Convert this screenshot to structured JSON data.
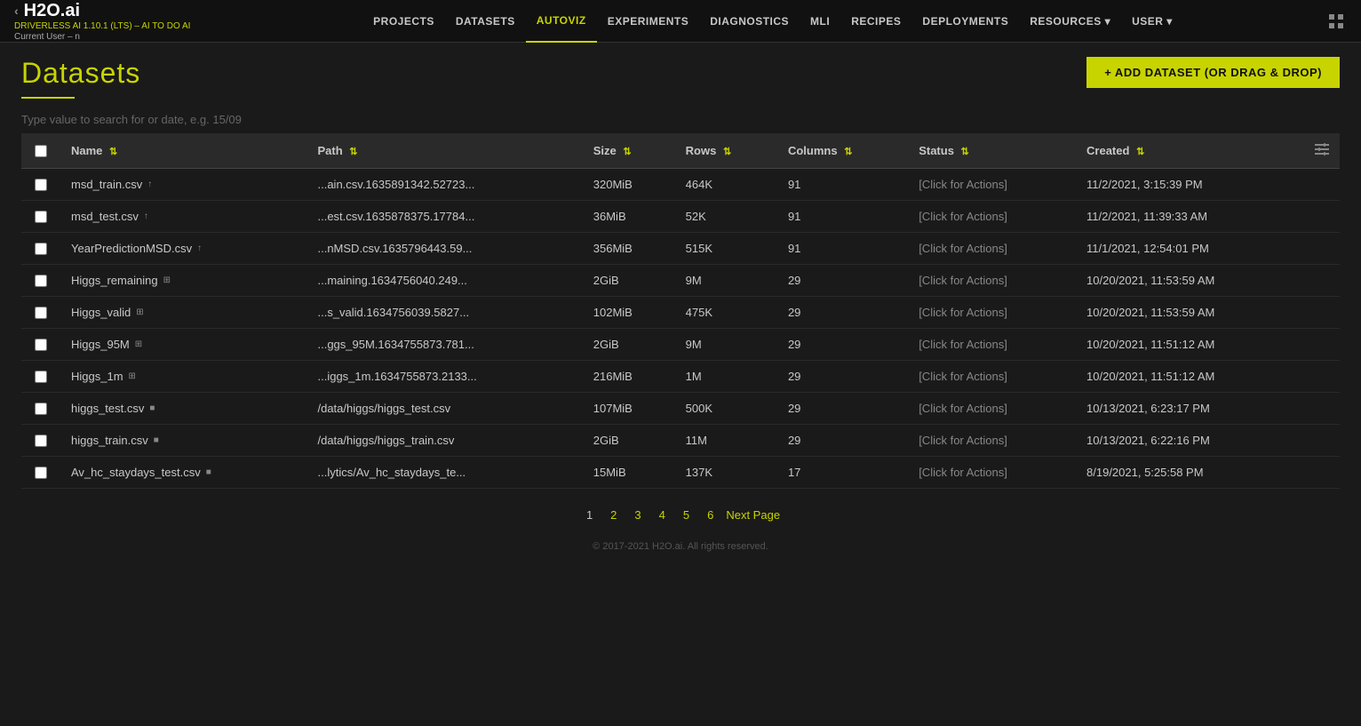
{
  "app": {
    "name": "H2O.ai",
    "subtitle": "DRIVERLESS AI 1.10.1 (LTS) – AI TO DO AI",
    "current_user": "Current User – n"
  },
  "nav": {
    "links": [
      {
        "label": "PROJECTS",
        "key": "projects"
      },
      {
        "label": "DATASETS",
        "key": "datasets"
      },
      {
        "label": "AUTOVIZ",
        "key": "autoviz",
        "active": true
      },
      {
        "label": "EXPERIMENTS",
        "key": "experiments"
      },
      {
        "label": "DIAGNOSTICS",
        "key": "diagnostics"
      },
      {
        "label": "MLI",
        "key": "mli"
      },
      {
        "label": "RECIPES",
        "key": "recipes"
      },
      {
        "label": "DEPLOYMENTS",
        "key": "deployments"
      },
      {
        "label": "RESOURCES ▾",
        "key": "resources"
      },
      {
        "label": "USER ▾",
        "key": "user"
      }
    ]
  },
  "page": {
    "title": "Datasets",
    "add_button": "+ ADD DATASET (OR DRAG & DROP)"
  },
  "search": {
    "placeholder": "Type value to search for or date, e.g. 15/09"
  },
  "table": {
    "columns": [
      {
        "label": "Name",
        "key": "name"
      },
      {
        "label": "Path",
        "key": "path"
      },
      {
        "label": "Size",
        "key": "size"
      },
      {
        "label": "Rows",
        "key": "rows"
      },
      {
        "label": "Columns",
        "key": "columns"
      },
      {
        "label": "Status",
        "key": "status"
      },
      {
        "label": "Created",
        "key": "created"
      }
    ],
    "rows": [
      {
        "name": "msd_train.csv",
        "icon": "↑",
        "path": "...ain.csv.1635891342.52723...",
        "size": "320MiB",
        "rows": "464K",
        "columns": "91",
        "status": "[Click for Actions]",
        "created": "11/2/2021, 3:15:39 PM"
      },
      {
        "name": "msd_test.csv",
        "icon": "↑",
        "path": "...est.csv.1635878375.17784...",
        "size": "36MiB",
        "rows": "52K",
        "columns": "91",
        "status": "[Click for Actions]",
        "created": "11/2/2021, 11:39:33 AM"
      },
      {
        "name": "YearPredictionMSD.csv",
        "icon": "↑",
        "path": "...nMSD.csv.1635796443.59...",
        "size": "356MiB",
        "rows": "515K",
        "columns": "91",
        "status": "[Click for Actions]",
        "created": "11/1/2021, 12:54:01 PM"
      },
      {
        "name": "Higgs_remaining",
        "icon": "⊞",
        "path": "...maining.1634756040.249...",
        "size": "2GiB",
        "rows": "9M",
        "columns": "29",
        "status": "[Click for Actions]",
        "created": "10/20/2021, 11:53:59 AM"
      },
      {
        "name": "Higgs_valid",
        "icon": "⊞",
        "path": "...s_valid.1634756039.5827...",
        "size": "102MiB",
        "rows": "475K",
        "columns": "29",
        "status": "[Click for Actions]",
        "created": "10/20/2021, 11:53:59 AM"
      },
      {
        "name": "Higgs_95M",
        "icon": "⊞",
        "path": "...ggs_95M.1634755873.781...",
        "size": "2GiB",
        "rows": "9M",
        "columns": "29",
        "status": "[Click for Actions]",
        "created": "10/20/2021, 11:51:12 AM"
      },
      {
        "name": "Higgs_1m",
        "icon": "⊞",
        "path": "...iggs_1m.1634755873.2133...",
        "size": "216MiB",
        "rows": "1M",
        "columns": "29",
        "status": "[Click for Actions]",
        "created": "10/20/2021, 11:51:12 AM"
      },
      {
        "name": "higgs_test.csv",
        "icon": "⬛",
        "path": "/data/higgs/higgs_test.csv",
        "size": "107MiB",
        "rows": "500K",
        "columns": "29",
        "status": "[Click for Actions]",
        "created": "10/13/2021, 6:23:17 PM"
      },
      {
        "name": "higgs_train.csv",
        "icon": "⬛",
        "path": "/data/higgs/higgs_train.csv",
        "size": "2GiB",
        "rows": "11M",
        "columns": "29",
        "status": "[Click for Actions]",
        "created": "10/13/2021, 6:22:16 PM"
      },
      {
        "name": "Av_hc_staydays_test.csv",
        "icon": "⬛",
        "path": "...lytics/Av_hc_staydays_te...",
        "size": "15MiB",
        "rows": "137K",
        "columns": "17",
        "status": "[Click for Actions]",
        "created": "8/19/2021, 5:25:58 PM"
      }
    ]
  },
  "pagination": {
    "pages": [
      "1",
      "2",
      "3",
      "4",
      "5",
      "6"
    ],
    "current": "1",
    "next_label": "Next Page"
  },
  "footer": {
    "copyright": "© 2017-2021 H2O.ai. All rights reserved."
  }
}
